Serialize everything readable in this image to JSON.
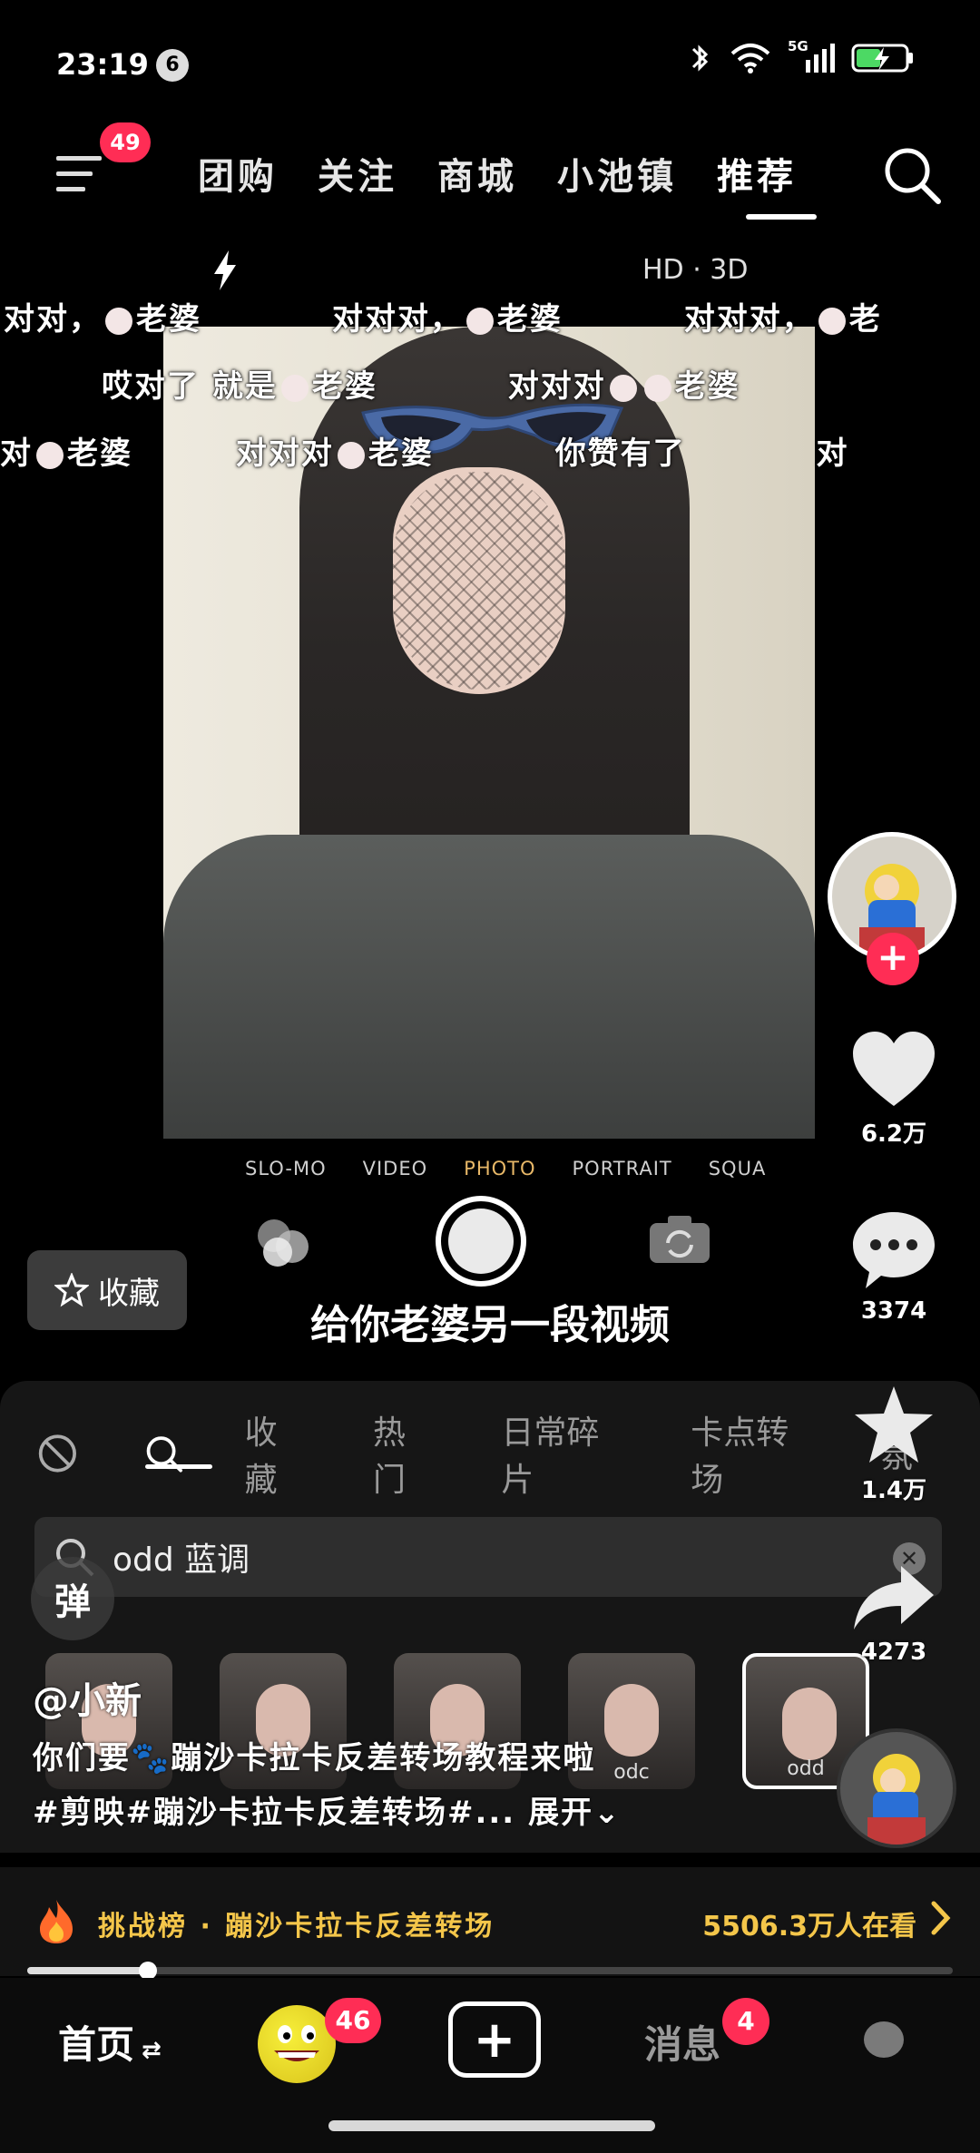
{
  "status_bar": {
    "time": "23:19",
    "notification_count": "6",
    "icons": [
      "bluetooth-icon",
      "wifi-icon",
      "5g-signal-icon",
      "battery-charging-icon"
    ],
    "network_label": "5G"
  },
  "top_nav": {
    "menu_badge": "49",
    "tabs": [
      "团购",
      "关注",
      "商城",
      "小池镇",
      "推荐"
    ],
    "active_tab": "推荐"
  },
  "camera_overlay": {
    "quality": "HD · 3D",
    "modes": [
      "SLO-MO",
      "VIDEO",
      "PHOTO",
      "PORTRAIT",
      "SQUA"
    ],
    "selected_mode": "PHOTO"
  },
  "danmaku": {
    "row1": [
      "对对，",
      "老婆",
      "对对对，",
      "老婆",
      "对对对，",
      "老"
    ],
    "row2": [
      "哎对了 就是",
      "老婆",
      "对对对",
      "老婆"
    ],
    "row3": [
      "对",
      "老婆",
      "对对对",
      "老婆",
      "你赞有了",
      "对"
    ]
  },
  "collect_button": {
    "label": "收藏"
  },
  "video_caption": "给你老婆另一段视频",
  "effect_panel": {
    "tabs": [
      "收藏",
      "热门",
      "日常碎片",
      "卡点转场",
      "氛"
    ],
    "search_value": "odd 蓝调",
    "thumb_labels": [
      "",
      "",
      "",
      "odc",
      "odd"
    ]
  },
  "danmaku_button": "弹",
  "author": "@小新",
  "description_line1": "你们要🐾蹦沙卡拉卡反差转场教程来啦",
  "description_line2": "#剪映#蹦沙卡拉卡反差转场#...",
  "expand_label": "展开",
  "actions": {
    "likes": "6.2万",
    "comments": "3374",
    "favorites": "1.4万",
    "shares": "4273"
  },
  "challenge": {
    "text": "挑战榜 · 蹦沙卡拉卡反差转场",
    "viewers": "5506.3万人在看"
  },
  "progress": 0.13,
  "bottom_nav": {
    "home": "首页",
    "friends_badge": "46",
    "messages": "消息",
    "messages_badge": "4"
  },
  "colors": {
    "accent_red": "#ff2d55",
    "challenge_gold": "#f4c64a"
  }
}
